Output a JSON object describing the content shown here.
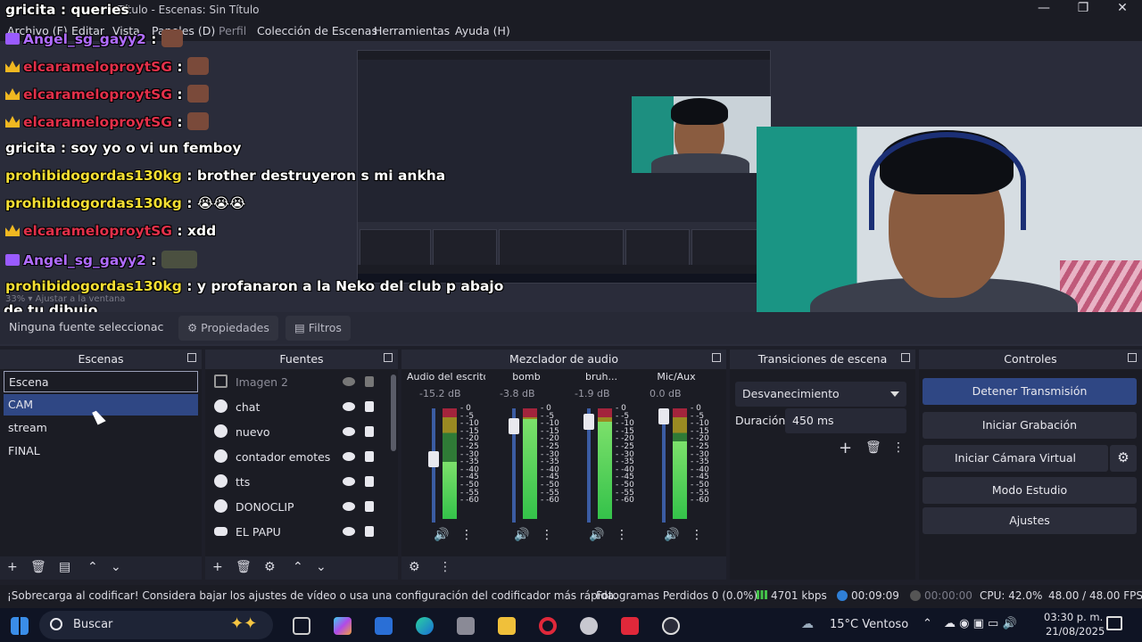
{
  "window": {
    "title": "Título - Escenas: Sin Título",
    "controls": [
      "—",
      "❐",
      "✕"
    ]
  },
  "menu": {
    "items": [
      "Archivo (F)",
      "Editar",
      "Vista",
      "Paneles (D)",
      "Perfil",
      "Colección de Escenas",
      "Herramientas",
      "Ayuda (H)"
    ]
  },
  "chat": {
    "lines": [
      {
        "user": "gricita",
        "msg": " : queries"
      },
      {
        "user": "Angel_sg_gayy2",
        "msg": " :"
      },
      {
        "user": "elcarameloproytSG",
        "msg": " :"
      },
      {
        "user": "elcarameloproytSG",
        "msg": " :"
      },
      {
        "user": "elcarameloproytSG",
        "msg": " :"
      },
      {
        "user": "gricita",
        "msg": " : soy yo o vi un femboy"
      },
      {
        "user": "prohibidogordas130kg",
        "msg": " : brother destruyeron s mi ankha"
      },
      {
        "user": "prohibidogordas130kg",
        "msg": " : 😭😭😭"
      },
      {
        "user": "elcarameloproytSG",
        "msg": " : xdd"
      },
      {
        "user": "Angel_sg_gayy2",
        "msg": " :"
      },
      {
        "user": "prohibidogordas130kg",
        "msg": " : y profanaron a la Neko del club p abajo"
      },
      {
        "user": "",
        "msg": "de tu dibujo"
      }
    ]
  },
  "preview": {
    "zoom_hint": "33%  ▾    Ajustar a la ventana"
  },
  "source_bar": {
    "no_source": "Ninguna fuente seleccionac",
    "properties": "⚙ Propiedades",
    "filters": "▤ Filtros"
  },
  "scenes": {
    "title": "Escenas",
    "items": [
      "Escena",
      "CAM",
      "stream",
      "FINAL"
    ]
  },
  "sources": {
    "title": "Fuentes",
    "items": [
      "Imagen 2",
      "chat",
      "nuevo",
      "contador emotes",
      "tts",
      "DONOCLIP",
      "EL PAPU"
    ]
  },
  "mixer": {
    "title": "Mezclador de audio",
    "channels": [
      {
        "name": "Audio del escrito",
        "db": "-15.2 dB",
        "fader": 0.56,
        "level": 0.52
      },
      {
        "name": "bomb",
        "db": "-3.8 dB",
        "fader": 0.9,
        "level": 0.9
      },
      {
        "name": "bruh...",
        "db": "-1.9 dB",
        "fader": 0.95,
        "level": 0.88
      },
      {
        "name": "Mic/Aux",
        "db": "0.0 dB",
        "fader": 1.0,
        "level": 0.7
      }
    ],
    "scale": [
      "0",
      "-5",
      "-10",
      "-15",
      "-20",
      "-25",
      "-30",
      "-35",
      "-40",
      "-45",
      "-50",
      "-55",
      "-60"
    ]
  },
  "transitions": {
    "title": "Transiciones de escena",
    "type": "Desvanecimiento",
    "duration_label": "Duración",
    "duration": "450 ms"
  },
  "controls": {
    "title": "Controles",
    "buttons": [
      "Detener Transmisión",
      "Iniciar Grabación",
      "Iniciar Cámara Virtual",
      "Modo Estudio",
      "Ajustes"
    ]
  },
  "status": {
    "warning": "¡Sobrecarga al codificar! Considera bajar los ajustes de vídeo o usa una configuración del codificador más rápida.",
    "dropped": "Fotogramas Perdidos 0 (0.0%)",
    "bitrate": "4701 kbps",
    "stream_time": "00:09:09",
    "rec_time": "00:00:00",
    "cpu": "CPU: 42.0%",
    "fps": "48.00 / 48.00 FPS"
  },
  "taskbar": {
    "search": "Buscar",
    "weather": "15°C  Ventoso",
    "time": "03:30 p. m.",
    "date": "21/08/2025"
  }
}
